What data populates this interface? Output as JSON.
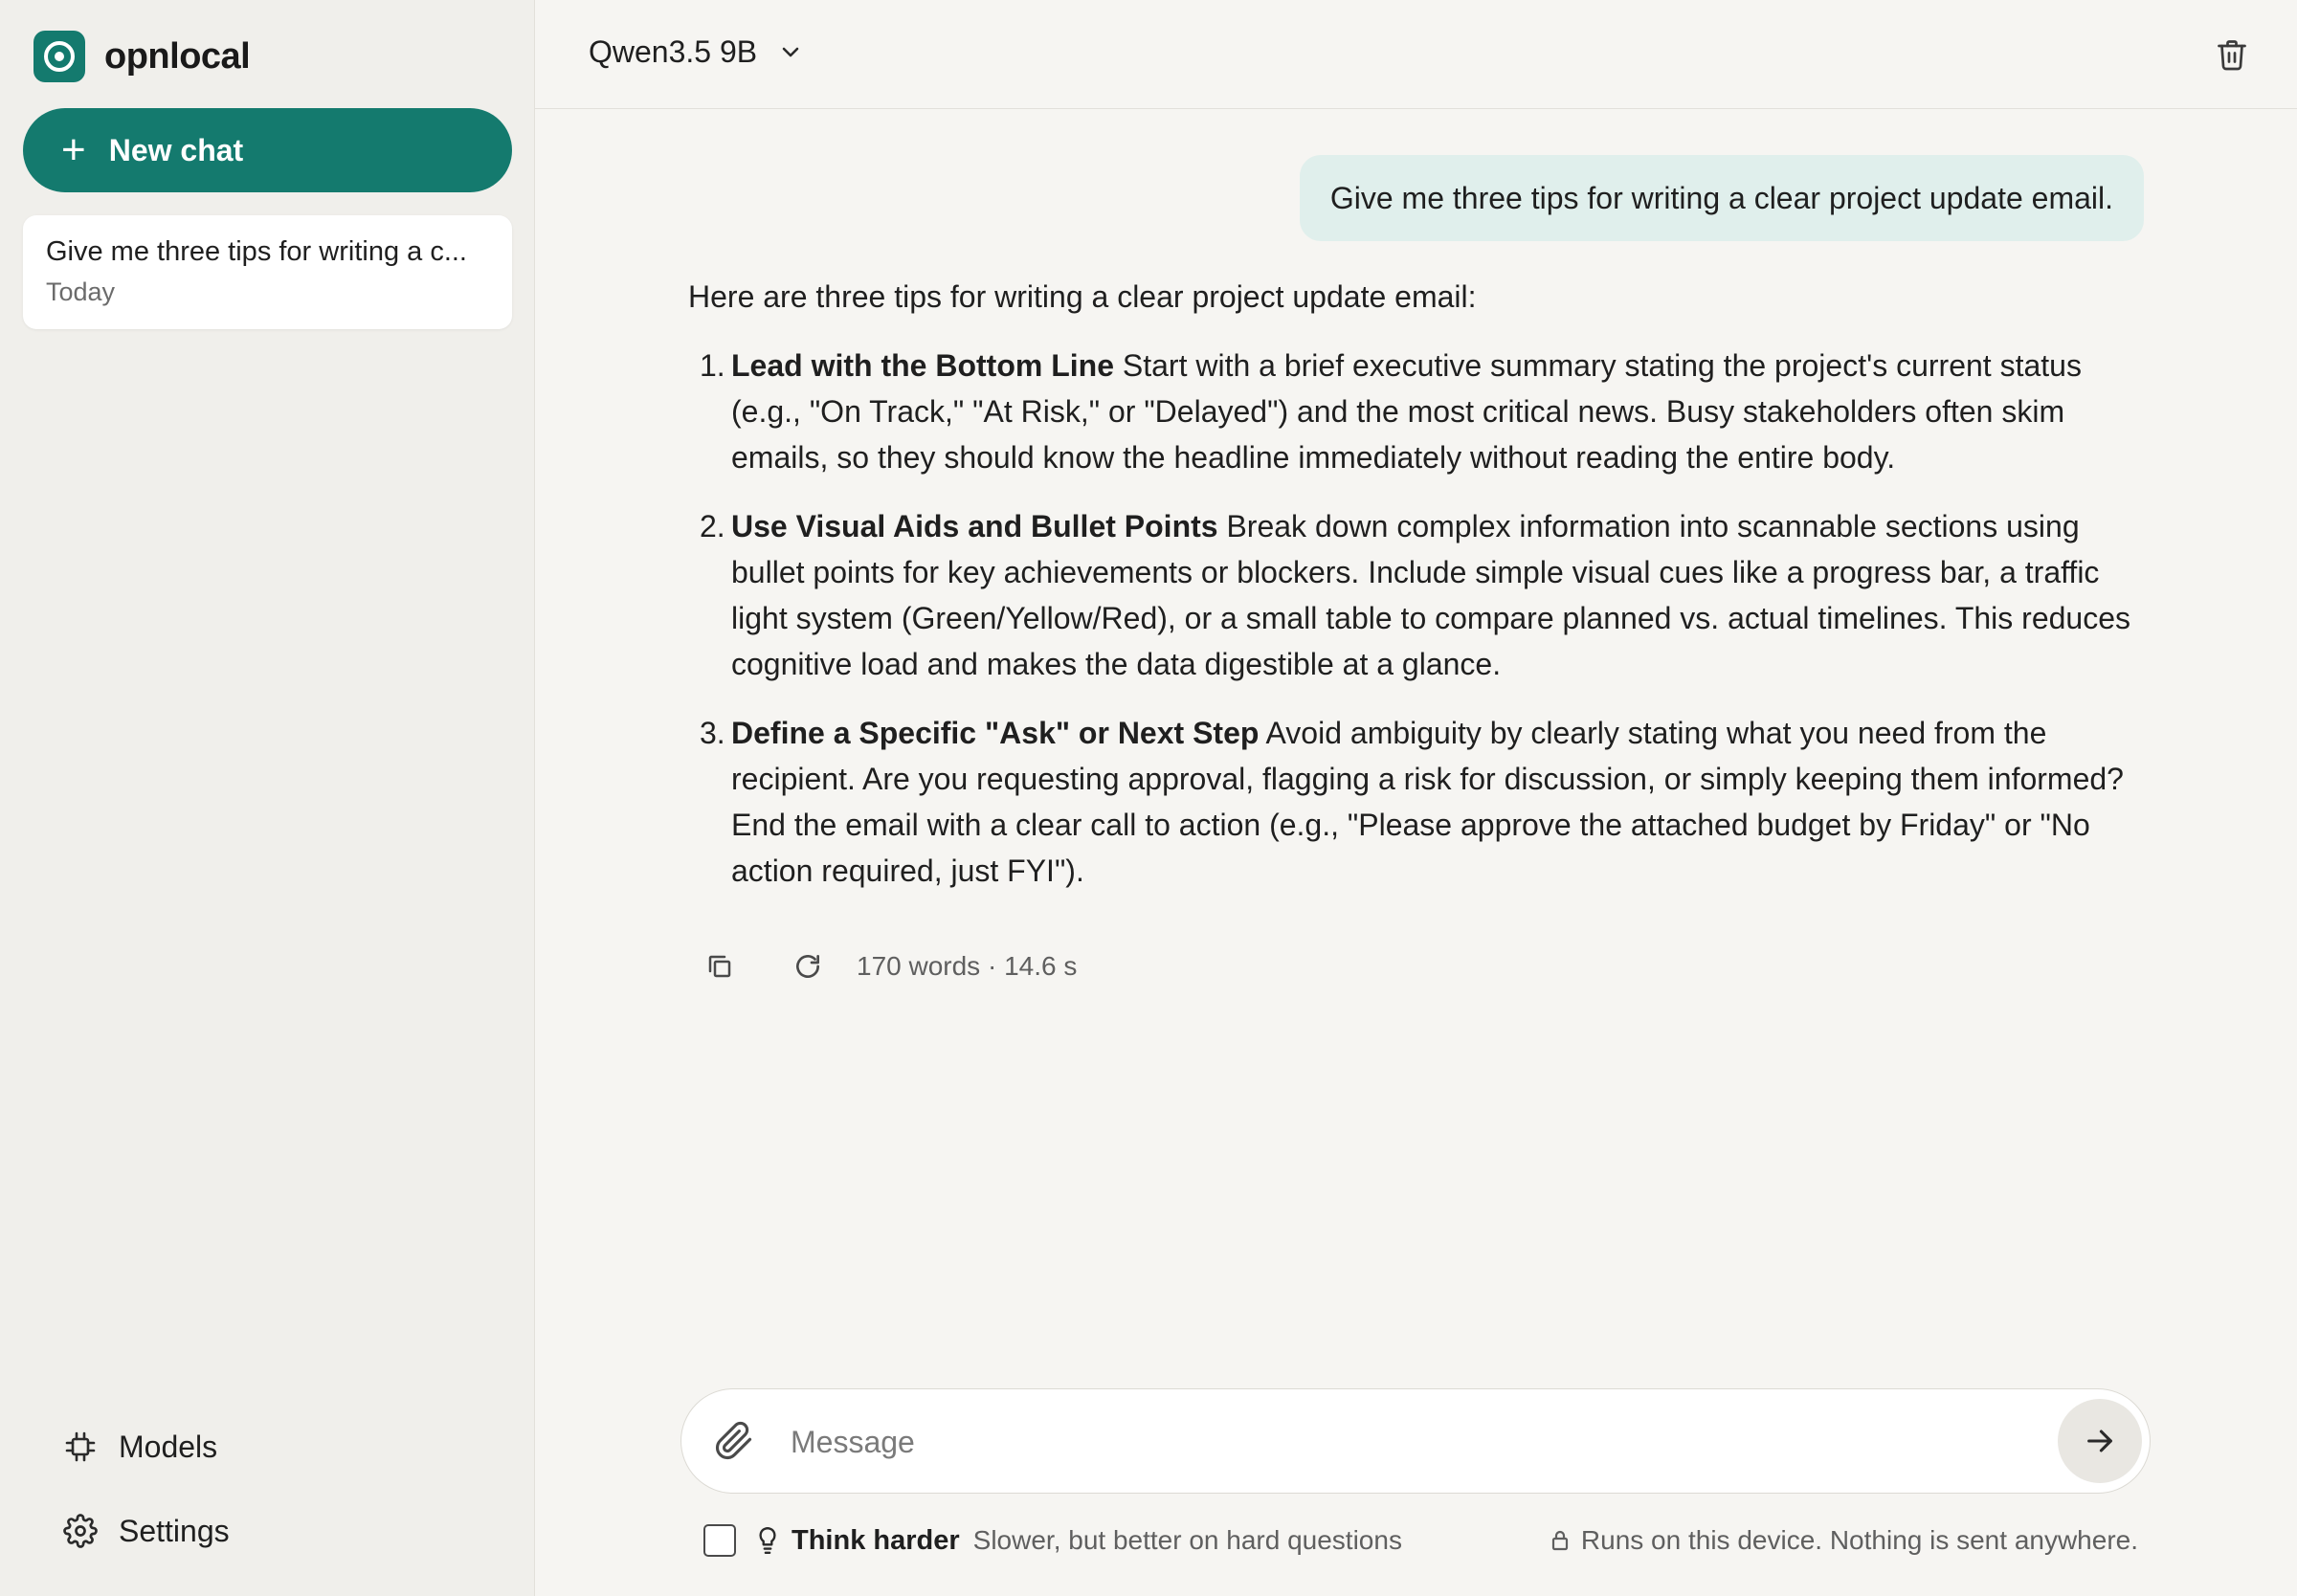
{
  "app": {
    "name": "opnlocal",
    "logo_icon": "target-circle-icon",
    "accent_color": "#147a6e"
  },
  "sidebar": {
    "new_chat_label": "New chat",
    "history": [
      {
        "title": "Give me three tips for writing a c...",
        "date": "Today"
      }
    ],
    "nav": [
      {
        "label": "Models",
        "icon": "chip-icon"
      },
      {
        "label": "Settings",
        "icon": "gear-icon"
      }
    ]
  },
  "header": {
    "model": "Qwen3.5 9B"
  },
  "conversation": {
    "user_message": "Give me three tips for writing a clear project update email.",
    "reply": {
      "intro": "Here are three tips for writing a clear project update email:",
      "tips": [
        {
          "number": "1.",
          "title": "Lead with the Bottom Line",
          "body": " Start with a brief executive summary stating the project's current status (e.g., \"On Track,\" \"At Risk,\" or \"Delayed\") and the most critical news. Busy stakeholders often skim emails, so they should know the headline immediately without reading the entire body."
        },
        {
          "number": "2.",
          "title": "Use Visual Aids and Bullet Points",
          "body": " Break down complex information into scannable sections using bullet points for key achievements or blockers. Include simple visual cues like a progress bar, a traffic light system (Green/Yellow/Red), or a small table to compare planned vs. actual timelines. This reduces cognitive load and makes the data digestible at a glance."
        },
        {
          "number": "3.",
          "title": "Define a Specific \"Ask\" or Next Step",
          "body": " Avoid ambiguity by clearly stating what you need from the recipient. Are you requesting approval, flagging a risk for discussion, or simply keeping them informed? End the email with a clear call to action (e.g., \"Please approve the attached budget by Friday\" or \"No action required, just FYI\")."
        }
      ],
      "stats": "170 words · 14.6 s"
    }
  },
  "composer": {
    "placeholder": "Message",
    "think_harder_label": "Think harder",
    "think_harder_hint": "Slower, but better on hard questions",
    "think_harder_checked": false,
    "privacy_note": "Runs on this device. Nothing is sent anywhere."
  }
}
